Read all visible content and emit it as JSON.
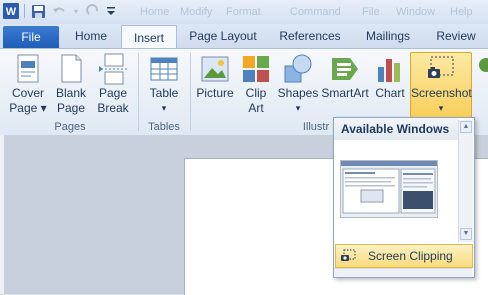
{
  "titlebar": {
    "faded_menu": [
      "Home",
      "Modify",
      "Format",
      "Command",
      "File",
      "Window",
      "Help"
    ]
  },
  "tabs": [
    "File",
    "Home",
    "Insert",
    "Page Layout",
    "References",
    "Mailings",
    "Review"
  ],
  "ribbon": {
    "pages": {
      "group": "Pages",
      "cover_page": [
        "Cover",
        "Page ▾"
      ],
      "blank_page": [
        "Blank",
        "Page"
      ],
      "page_break": [
        "Page",
        "Break"
      ]
    },
    "tables": {
      "group": "Tables",
      "table": [
        "Table",
        "▾"
      ]
    },
    "illustrations": {
      "group": "Illustr",
      "picture": "Picture",
      "clip_art": [
        "Clip",
        "Art"
      ],
      "shapes": [
        "Shapes",
        "▾"
      ],
      "smartart": "SmartArt",
      "chart": "Chart",
      "screenshot": [
        "Screenshot",
        "▾"
      ]
    }
  },
  "dropdown": {
    "header": "Available Windows",
    "screen_clipping": "Screen Clipping"
  },
  "colors": {
    "file_tab": "#2b6cc4",
    "highlight": "#f9d66a"
  }
}
